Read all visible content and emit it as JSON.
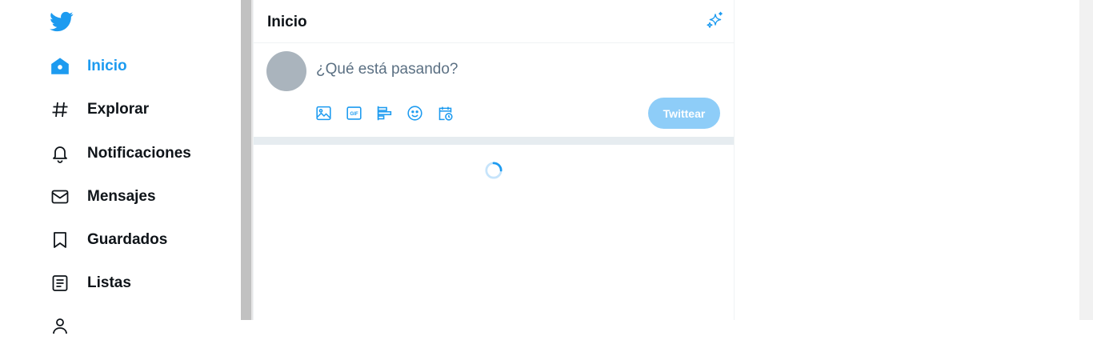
{
  "nav": {
    "items": [
      {
        "label": "Inicio",
        "icon": "home-icon",
        "active": true
      },
      {
        "label": "Explorar",
        "icon": "hashtag-icon"
      },
      {
        "label": "Notificaciones",
        "icon": "bell-icon"
      },
      {
        "label": "Mensajes",
        "icon": "mail-icon"
      },
      {
        "label": "Guardados",
        "icon": "bookmark-icon"
      },
      {
        "label": "Listas",
        "icon": "list-icon"
      }
    ]
  },
  "header": {
    "title": "Inicio"
  },
  "composer": {
    "placeholder": "¿Qué está pasando?",
    "tweet_label": "Twittear",
    "tools": [
      "image-icon",
      "gif-icon",
      "poll-icon",
      "emoji-icon",
      "schedule-icon"
    ]
  },
  "colors": {
    "accent": "#1d9bf0",
    "button_disabled": "#8ecdf8",
    "avatar": "#aab4bd"
  }
}
